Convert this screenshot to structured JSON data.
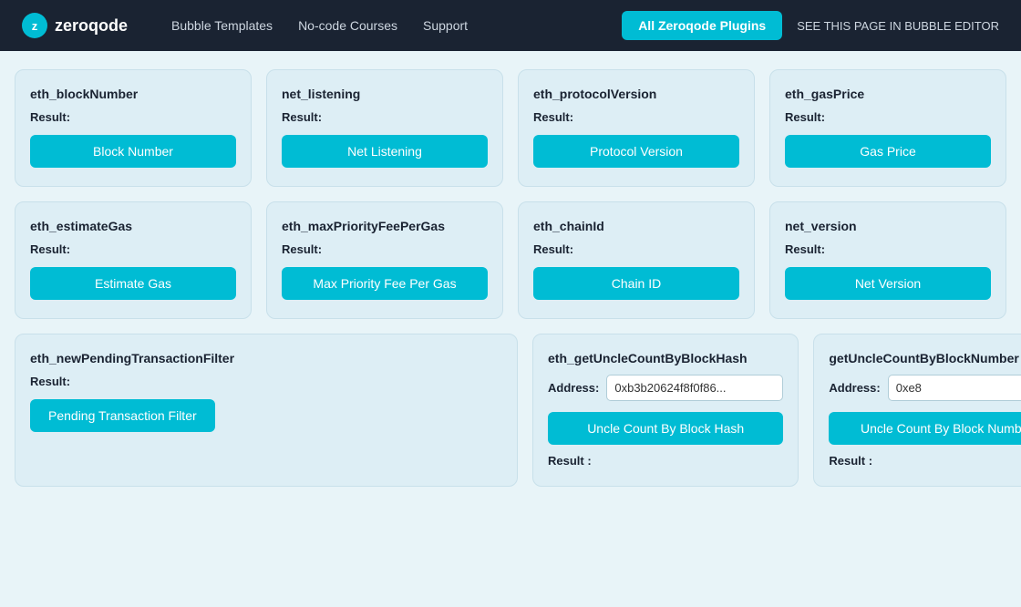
{
  "nav": {
    "logo_letter": "z",
    "logo_text": "zeroqode",
    "links": [
      {
        "label": "Bubble Templates",
        "href": "#"
      },
      {
        "label": "No-code Courses",
        "href": "#"
      },
      {
        "label": "Support",
        "href": "#"
      }
    ],
    "cta_label": "All Zeroqode Plugins",
    "editor_label": "SEE THIS PAGE IN BUBBLE EDITOR"
  },
  "cards_row1": [
    {
      "title": "eth_blockNumber",
      "result_label": "Result:",
      "btn_label": "Block Number"
    },
    {
      "title": "net_listening",
      "result_label": "Result:",
      "btn_label": "Net Listening"
    },
    {
      "title": "eth_protocolVersion",
      "result_label": "Result:",
      "btn_label": "Protocol Version"
    },
    {
      "title": "eth_gasPrice",
      "result_label": "Result:",
      "btn_label": "Gas Price"
    }
  ],
  "cards_row2": [
    {
      "title": "eth_estimateGas",
      "result_label": "Result:",
      "btn_label": "Estimate Gas"
    },
    {
      "title": "eth_maxPriorityFeePerGas",
      "result_label": "Result:",
      "btn_label": "Max Priority Fee Per Gas"
    },
    {
      "title": "eth_chainId",
      "result_label": "Result:",
      "btn_label": "Chain ID"
    },
    {
      "title": "net_version",
      "result_label": "Result:",
      "btn_label": "Net Version"
    }
  ],
  "cards_row3": [
    {
      "title": "eth_newPendingTransactionFilter",
      "result_label": "Result:",
      "btn_label": "Pending Transaction Filter",
      "has_address": false,
      "has_result_colon": false
    },
    {
      "title": "eth_getUncleCountByBlockHash",
      "result_label": "",
      "btn_label": "Uncle Count By Block Hash",
      "has_address": true,
      "address_label": "Address:",
      "address_value": "0xb3b20624f8f0f86...",
      "result_colon": "Result :"
    },
    {
      "title": "getUncleCountByBlockNumber",
      "result_label": "",
      "btn_label": "Uncle Count By Block Number",
      "has_address": true,
      "address_label": "Address:",
      "address_value": "0xe8",
      "result_colon": "Result :"
    }
  ]
}
